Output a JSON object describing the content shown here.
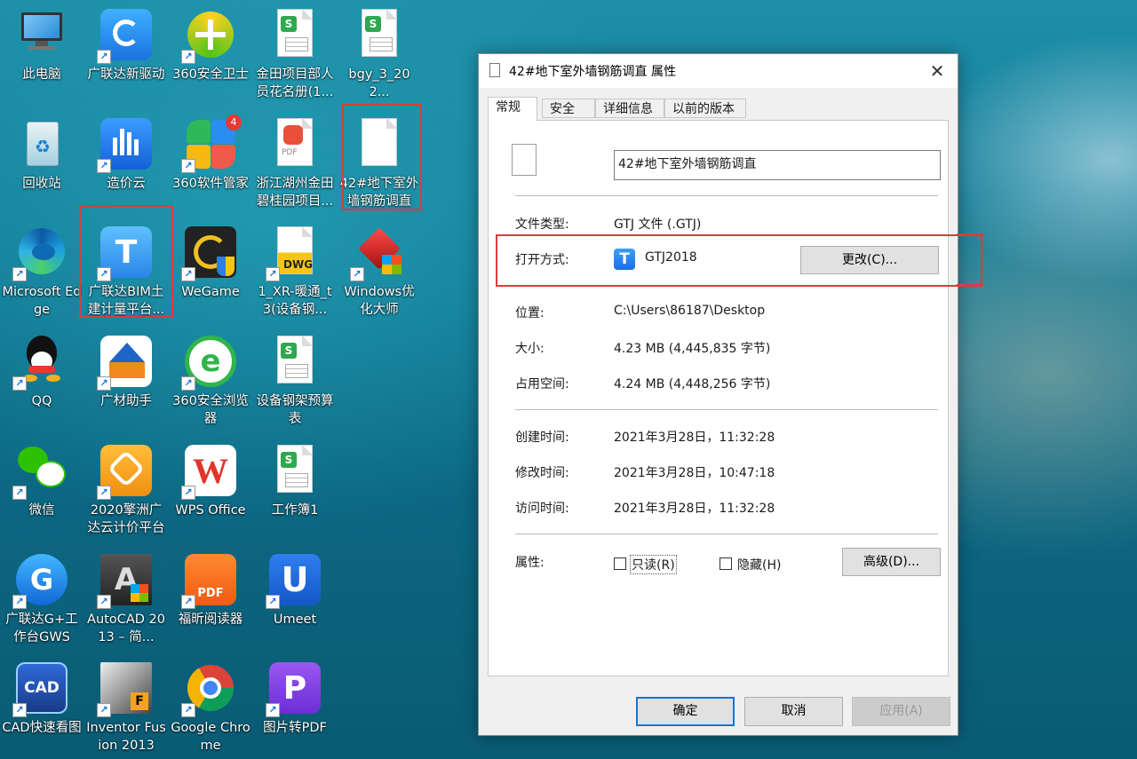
{
  "desktop": {
    "icons": [
      {
        "label": "此电脑"
      },
      {
        "label": "广联达新驱动"
      },
      {
        "label": "360安全卫士"
      },
      {
        "label": "金田项目部人员花名册(1..."
      },
      {
        "label": "bgy_3_202..."
      },
      {
        "label": "回收站"
      },
      {
        "label": "造价云"
      },
      {
        "label": "360软件管家",
        "badge": "4"
      },
      {
        "label": "浙江湖州金田碧桂园项目...",
        "tile_text": "PDF"
      },
      {
        "label": "42#地下室外墙钢筋调直"
      },
      {
        "label": "Microsoft Edge"
      },
      {
        "label": "广联达BIM土建计量平台...",
        "tile_text": "T"
      },
      {
        "label": "WeGame"
      },
      {
        "label": "1_XR-暖通_t3(设备钢...",
        "tile_text": "DWG"
      },
      {
        "label": "Windows优化大师"
      },
      {
        "label": "QQ"
      },
      {
        "label": "广材助手"
      },
      {
        "label": "360安全浏览器",
        "tile_text": "e"
      },
      {
        "label": "设备钢架预算表"
      },
      {
        "label": "微信"
      },
      {
        "label": "2020擎洲广达云计价平台"
      },
      {
        "label": "WPS Office",
        "tile_text": "W"
      },
      {
        "label": "工作簿1"
      },
      {
        "label": "广联达G+工作台GWS",
        "tile_text": "G"
      },
      {
        "label": "AutoCAD 2013 – 简...",
        "tile_text": "A"
      },
      {
        "label": "福昕阅读器",
        "tile_text": "PDF"
      },
      {
        "label": "Umeet",
        "tile_text": "U"
      },
      {
        "label": "CAD快速看图",
        "tile_text": "CAD"
      },
      {
        "label": "Inventor Fusion 2013",
        "tile_text": "F"
      },
      {
        "label": "Google Chrome"
      },
      {
        "label": "图片转PDF",
        "tile_text": "P"
      }
    ]
  },
  "dialog": {
    "title": "42#地下室外墙钢筋调直 属性",
    "tabs": [
      "常规",
      "安全",
      "详细信息",
      "以前的版本"
    ],
    "file_name": "42#地下室外墙钢筋调直",
    "fields": {
      "type_label": "文件类型:",
      "type_value": "GTJ 文件 (.GTJ)",
      "open_label": "打开方式:",
      "open_value": "GTJ2018",
      "change_button": "更改(C)...",
      "location_label": "位置:",
      "location_value": "C:\\Users\\86187\\Desktop",
      "size_label": "大小:",
      "size_value": "4.23 MB (4,445,835 字节)",
      "disk_label": "占用空间:",
      "disk_value": "4.24 MB (4,448,256 字节)",
      "created_label": "创建时间:",
      "created_value": "2021年3月28日，11:32:28",
      "modified_label": "修改时间:",
      "modified_value": "2021年3月28日，10:47:18",
      "accessed_label": "访问时间:",
      "accessed_value": "2021年3月28日，11:32:28",
      "attr_label": "属性:",
      "readonly_label": "只读(R)",
      "hidden_label": "隐藏(H)",
      "advanced_button": "高级(D)..."
    },
    "buttons": {
      "ok": "确定",
      "cancel": "取消",
      "apply": "应用(A)"
    },
    "app_icon_text": "T",
    "close_glyph": "✕"
  },
  "colors": {
    "highlight": "#e03a3a",
    "accent": "#1a73d0"
  }
}
